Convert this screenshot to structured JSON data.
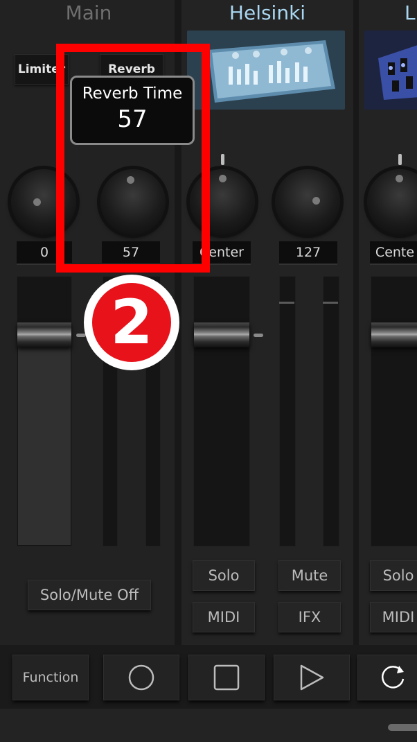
{
  "channels": {
    "main": {
      "title": "Main",
      "buttons": [
        "Limiter",
        "Reverb"
      ],
      "knob_values": [
        "0",
        "57"
      ],
      "solo_mute_label": "Solo/Mute Off"
    },
    "helsinki": {
      "title": "Helsinki",
      "knob_values": [
        "Center",
        "127"
      ],
      "buttons": {
        "solo": "Solo",
        "mute": "Mute",
        "midi": "MIDI",
        "ifx": "IFX"
      }
    },
    "next": {
      "title": "L",
      "knob_value": "Cente",
      "buttons": {
        "solo": "Solo",
        "midi": "MIDI"
      }
    }
  },
  "popup": {
    "title": "Reverb Time",
    "value": "57"
  },
  "annotation": {
    "badge_number": "2",
    "colors": {
      "frame": "#ff0000",
      "badge": "#e8121b"
    }
  },
  "transport": {
    "function_label": "Function",
    "icons": [
      "record-icon",
      "stop-icon",
      "play-icon",
      "loop-icon"
    ]
  },
  "colors": {
    "accent_title": "#a9d7f2",
    "background": "#1c1c1c"
  }
}
